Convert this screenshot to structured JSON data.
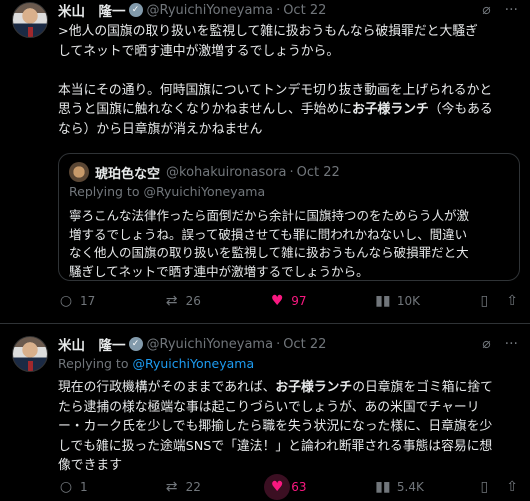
{
  "tweets": [
    {
      "name": "米山　隆一",
      "handle": "@RyuichiYoneyama",
      "date": "Oct 22",
      "body_lines": [
        ">他人の国旗の取り扱いを監視して雑に扱おうもんなら破損罪だと大騒ぎ",
        "してネットで晒す連中が激増するでしょうから。",
        "",
        "本当にその通り。何時国旗についてトンデモ切り抜き動画を上げられるかと",
        "思うと国旗に触れなくなりかねませんし、手始めに",
        "お子様ランチ",
        "（今もある",
        "なら）から日章旗が消えかねません"
      ],
      "quote": {
        "name": "琥珀色な空",
        "handle": "@kohakuironasora",
        "date": "Oct 22",
        "replying_prefix": "Replying to ",
        "replying_to": "@RyuichiYoneyama",
        "body": "寧ろこんな法律作ったら面倒だから余計に国旗持つのをためらう人が激\n増するでしょうね。誤って破損させても罪に問われかねないし、間違い\nなく他人の国旗の取り扱いを監視して雑に扱おうもんなら破損罪だと大\n騒ぎしてネットで晒す連中が激増するでしょうから。"
      },
      "actions": {
        "replies": "17",
        "retweets": "26",
        "likes": "97",
        "views": "10K"
      }
    },
    {
      "name": "米山　隆一",
      "handle": "@RyuichiYoneyama",
      "date": "Oct 22",
      "replying_prefix": "Replying to ",
      "replying_to": "@RyuichiYoneyama",
      "body_lines": [
        "現在の行政機構がそのままであれば、",
        "お子様ランチ",
        "の日章旗をゴミ箱に捨て",
        "たら逮捕の様な極端な事は起こりづらいでしょうが、あの米国でチャーリ",
        "ー・カーク氏を少しでも揶揄したら職を失う状況になった様に、日章旗を少",
        "しでも雑に扱った途端SNSで「違法！」と論われ断罪される事態は容易に想",
        "像できます"
      ],
      "actions": {
        "replies": "1",
        "retweets": "22",
        "likes": "63",
        "views": "5.4K"
      }
    }
  ],
  "icons": {
    "grok": "grok-icon",
    "more": "more-icon",
    "reply": "reply-icon",
    "retweet": "retweet-icon",
    "like": "heart-icon",
    "views": "views-icon",
    "bookmark": "bookmark-icon",
    "share": "share-icon"
  },
  "colors": {
    "link": "#1d9bf0",
    "like": "#f91880",
    "muted": "#71767b"
  }
}
